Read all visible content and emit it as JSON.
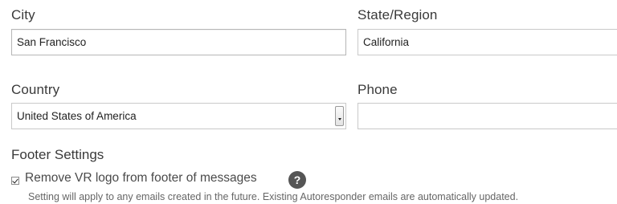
{
  "form": {
    "city": {
      "label": "City",
      "value": "San Francisco"
    },
    "state": {
      "label": "State/Region",
      "value": "California"
    },
    "country": {
      "label": "Country",
      "value": "United States of America"
    },
    "phone": {
      "label": "Phone",
      "value": ""
    }
  },
  "footer": {
    "title": "Footer Settings",
    "checkbox_label": "Remove VR logo from footer of messages",
    "checkbox_checked": true,
    "help_icon": "question-circle-icon",
    "help_glyph": "?",
    "hint": "Setting will apply to any emails created in the future. Existing Autoresponder emails are automatically updated."
  }
}
